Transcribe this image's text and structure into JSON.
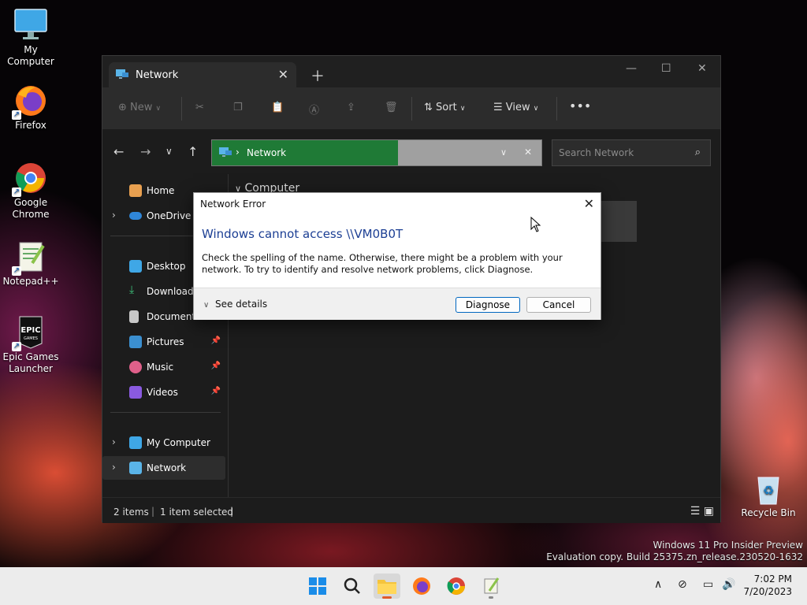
{
  "desktop": {
    "icons": [
      {
        "label": "My Computer"
      },
      {
        "label": "Firefox"
      },
      {
        "label": "Google Chrome"
      },
      {
        "label": "Notepad++"
      },
      {
        "label": "Epic Games Launcher"
      },
      {
        "label": "Recycle Bin"
      }
    ],
    "watermark": {
      "line1": "Windows 11 Pro Insider Preview",
      "line2": "Evaluation copy. Build 25375.zn_release.230520-1632"
    }
  },
  "explorer": {
    "tab_title": "Network",
    "toolbar": {
      "new": "New",
      "sort": "Sort",
      "view": "View"
    },
    "address": {
      "path": "Network"
    },
    "search": {
      "placeholder": "Search Network"
    },
    "sidebar": {
      "items": [
        {
          "label": "Home"
        },
        {
          "label": "OneDrive"
        },
        {
          "label": "Desktop"
        },
        {
          "label": "Downloads"
        },
        {
          "label": "Documents"
        },
        {
          "label": "Pictures"
        },
        {
          "label": "Music"
        },
        {
          "label": "Videos"
        },
        {
          "label": "My Computer"
        },
        {
          "label": "Network"
        }
      ]
    },
    "content": {
      "group_header": "Computer"
    },
    "status": {
      "items": "2 items",
      "selected": "1 item selected"
    }
  },
  "dialog": {
    "title": "Network Error",
    "heading": "Windows cannot access \\\\VM0B0T",
    "body": "Check the spelling of the name. Otherwise, there might be a problem with your network. To try to identify and resolve network problems, click Diagnose.",
    "see_details": "See details",
    "diagnose": "Diagnose",
    "cancel": "Cancel"
  },
  "taskbar": {
    "time": "7:02 PM",
    "date": "7/20/2023"
  },
  "colors": {
    "accent": "#0067c0",
    "address_highlight": "#1f7a36",
    "dialog_heading": "#1c3f94"
  }
}
